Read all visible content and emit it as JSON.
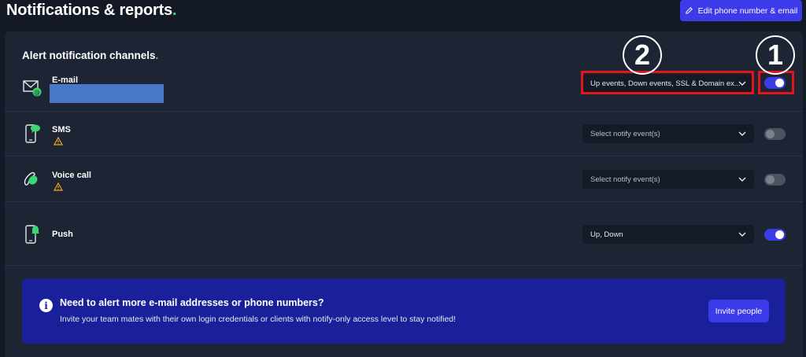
{
  "header": {
    "title": "Notifications & reports",
    "title_dot": ".",
    "edit_button_label": "Edit phone number & email"
  },
  "panel": {
    "title": "Alert notification channels",
    "title_dot": "."
  },
  "channels": [
    {
      "name": "E-mail",
      "icon": "email-icon",
      "select_value": "Up events, Down events, SSL & Domain ex...",
      "toggle_on": true,
      "warning": false
    },
    {
      "name": "SMS",
      "icon": "sms-phone-icon",
      "select_value": "Select notify event(s)",
      "toggle_on": false,
      "warning": true
    },
    {
      "name": "Voice call",
      "icon": "voice-call-icon",
      "select_value": "Select notify event(s)",
      "toggle_on": false,
      "warning": true
    },
    {
      "name": "Push",
      "icon": "push-phone-icon",
      "select_value": "Up, Down",
      "toggle_on": true,
      "warning": false
    }
  ],
  "annotations": {
    "marker_1": "1",
    "marker_2": "2",
    "highlight_color": "#e4141b"
  },
  "banner": {
    "title": "Need to alert more e-mail addresses or phone numbers?",
    "text": "Invite your team mates with their own login credentials or clients with notify-only access level to stay notified!",
    "button_label": "Invite people",
    "info_glyph": "i"
  },
  "colors": {
    "accent": "#3b3bea",
    "green": "#3bd671",
    "banner_bg": "#1a1f9a",
    "warning": "#f5a623"
  }
}
